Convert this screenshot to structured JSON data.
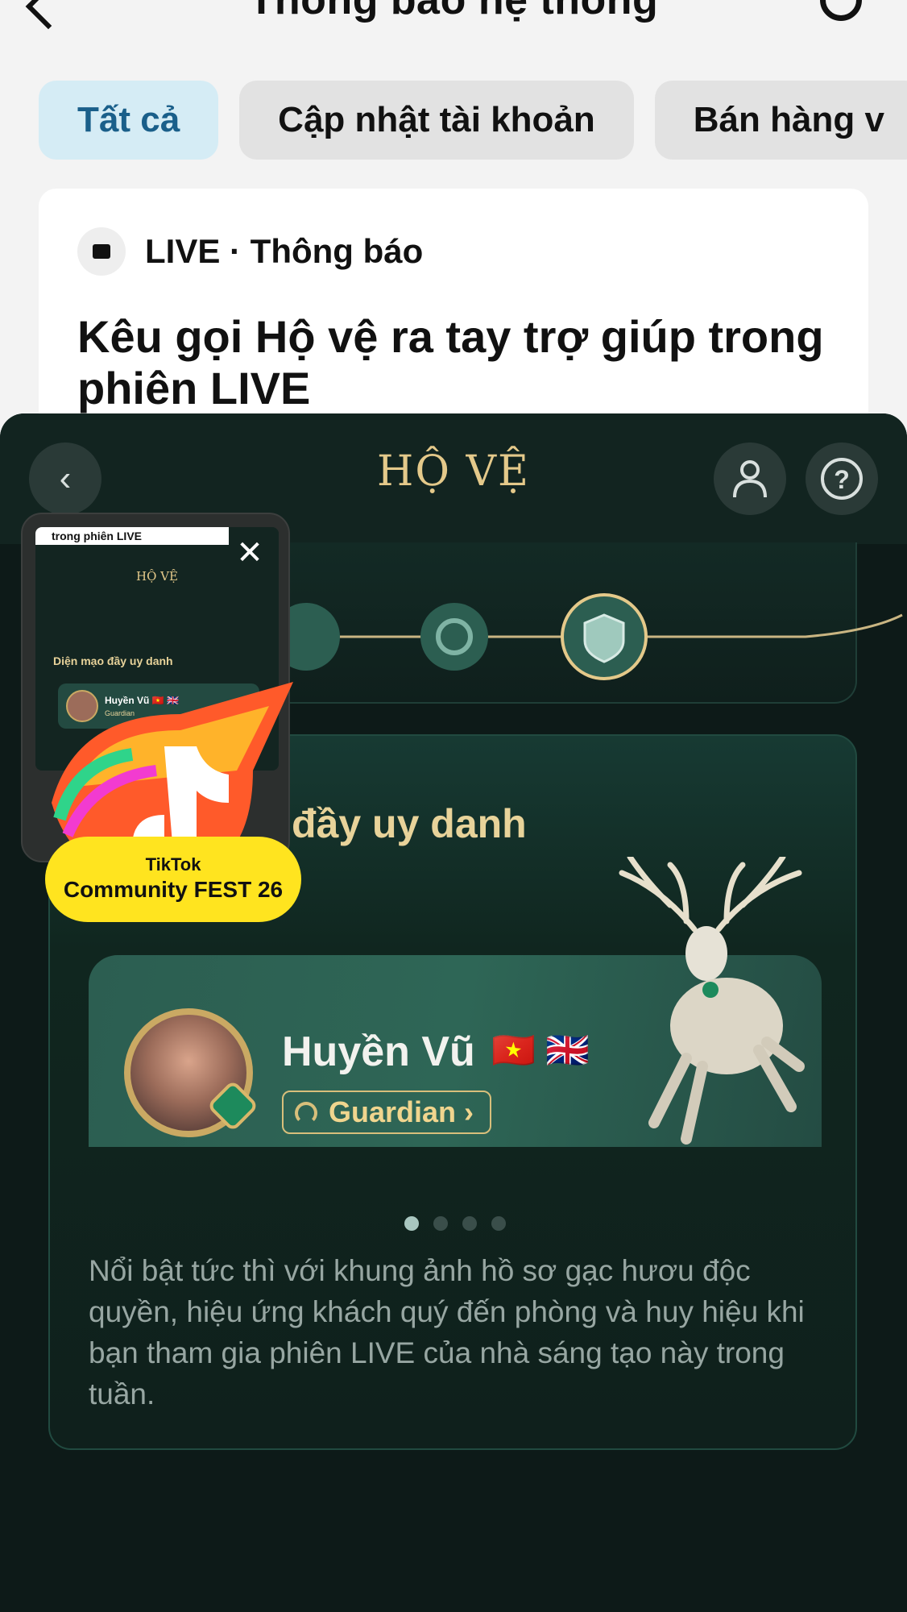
{
  "header": {
    "title": "Thông báo hệ thống"
  },
  "tabs": [
    {
      "label": "Tất cả",
      "active": true
    },
    {
      "label": "Cập nhật tài khoản",
      "active": false
    },
    {
      "label": "Bán hàng v",
      "active": false
    }
  ],
  "notification": {
    "source": "LIVE · Thông báo",
    "title": "Kêu gọi Hộ vệ ra tay trợ giúp trong phiên LIVE"
  },
  "panel": {
    "title": "HỘ VỆ",
    "section_title": "đầy uy danh",
    "profile": {
      "name": "Huyền Vũ",
      "flags": "🇻🇳 🇬🇧",
      "badge": "Guardian ›"
    },
    "carousel": {
      "count": 4,
      "active_index": 0
    },
    "description": "Nổi bật tức thì với khung ảnh hồ sơ gạc hươu độc quyền, hiệu ứng khách quý đến phòng và huy hiệu khi bạn tham gia phiên LIVE của nhà sáng tạo này trong tuần."
  },
  "pip": {
    "close": "✕",
    "top_text": "trong phiên LIVE",
    "title": "HỘ VỆ",
    "section": "Diện mạo đầy uy danh",
    "name": "Huyền Vũ 🇻🇳 🇬🇧",
    "badge": "Guardian"
  },
  "sticker": {
    "line1": "TikTok",
    "line2": "Community FEST 26"
  },
  "colors": {
    "gold": "#e4c98a",
    "panel_bg": "#0d1a18",
    "active_chip": "#d5ecf5"
  }
}
